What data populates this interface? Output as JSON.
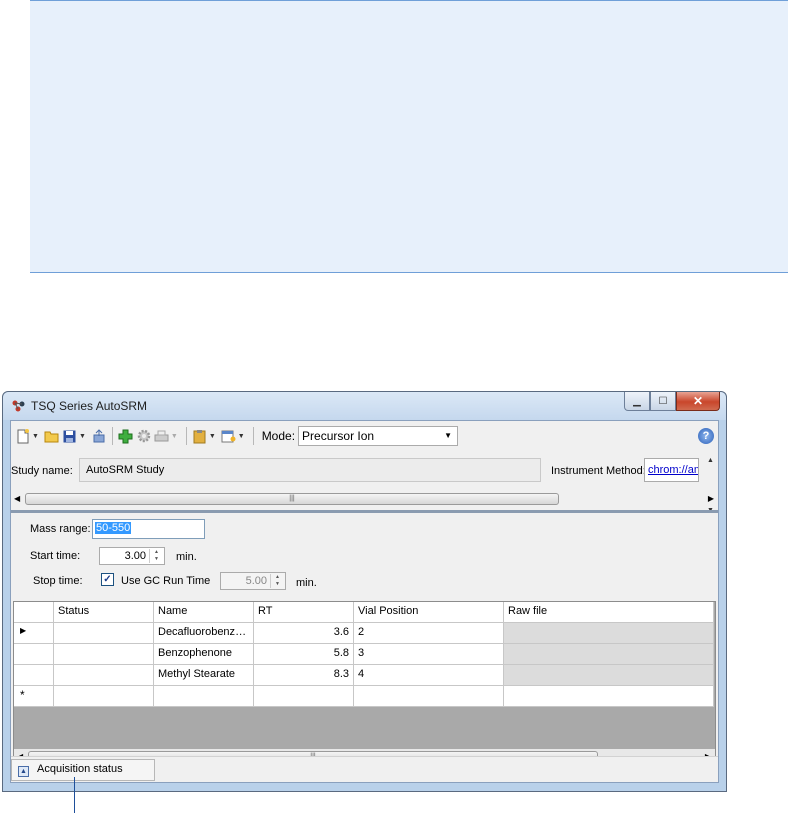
{
  "window": {
    "title": "TSQ Series AutoSRM"
  },
  "toolbar": {
    "mode_label": "Mode:",
    "mode_value": "Precursor Ion",
    "icons": [
      "new-icon",
      "open-icon",
      "save-icon",
      "export-icon",
      "add-sample-icon",
      "settings-icon",
      "print-icon",
      "paste-icon",
      "properties-icon",
      "help-icon"
    ]
  },
  "study": {
    "name_label": "Study name:",
    "name_value": "AutoSRM Study",
    "instrument_label": "Instrument Method:",
    "instrument_value": "chrom://am"
  },
  "params": {
    "mass_range_label": "Mass range:",
    "mass_range_value": "50-550",
    "start_time_label": "Start time:",
    "start_time_value": "3.00",
    "start_unit": "min.",
    "stop_time_label": "Stop time:",
    "use_gc_label": "Use GC Run Time",
    "use_gc_checked": true,
    "stop_time_value": "5.00",
    "stop_unit": "min."
  },
  "grid": {
    "columns": [
      "Status",
      "Name",
      "RT",
      "Vial Position",
      "Raw file"
    ],
    "rows": [
      {
        "marker": "▶",
        "status": "",
        "name": "Decafluorobenzo...",
        "rt": "3.6",
        "vial": "2",
        "raw": ""
      },
      {
        "marker": "",
        "status": "",
        "name": "Benzophenone",
        "rt": "5.8",
        "vial": "3",
        "raw": ""
      },
      {
        "marker": "",
        "status": "",
        "name": "Methyl Stearate",
        "rt": "8.3",
        "vial": "4",
        "raw": ""
      }
    ],
    "new_row_marker": "*"
  },
  "statusbar": {
    "acquisition_label": "Acquisition status"
  },
  "colors": {
    "callout_bg": "#e7f0fb",
    "callout_border": "#6f9fd8",
    "selection": "#3399ff"
  }
}
